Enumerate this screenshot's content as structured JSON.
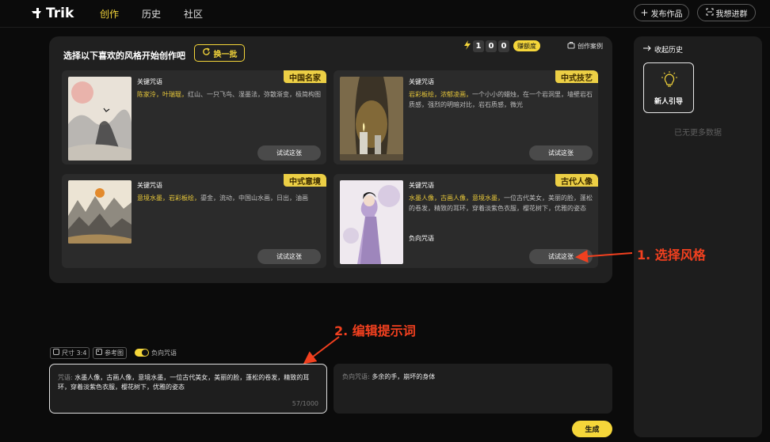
{
  "brand": {
    "name": "Trik"
  },
  "nav": [
    {
      "label": "创作",
      "active": true
    },
    {
      "label": "历史",
      "active": false
    },
    {
      "label": "社区",
      "active": false
    }
  ],
  "header_actions": {
    "publish": "发布作品",
    "join_group": "我想进群"
  },
  "panel": {
    "title": "选择以下喜欢的风格开始创作吧",
    "swap_button": "换一批",
    "credits": [
      "1",
      "0",
      "0"
    ],
    "quota_label": "赚额度",
    "cases_label": "创作案例"
  },
  "cards": [
    {
      "tag": "中国名家",
      "keyword_label": "关键咒语",
      "highlights": "陈家泠，叶瑞琨，",
      "desc": "红山、一只飞鸟、湿墨法，弥散渐变，极简构图",
      "negative_label": "",
      "button": "试试这张"
    },
    {
      "tag": "中式技艺",
      "keyword_label": "关键咒语",
      "highlights": "岩彩板绘，浓郁凌画，",
      "desc": "一个小小的蜡烛，在一个岩洞里，墙壁岩石质感，强烈的明暗对比，岩石质感，微光",
      "negative_label": "",
      "button": "试试这张"
    },
    {
      "tag": "中式意境",
      "keyword_label": "关键咒语",
      "highlights": "意境水墨，岩彩板绘，",
      "desc": "鎏金，流动，中国山水画，日出，油画",
      "negative_label": "",
      "button": "试试这张"
    },
    {
      "tag": "古代人像",
      "keyword_label": "关键咒语",
      "highlights": "水墨人像，古画人像，意境水墨，",
      "desc": "一位古代美女，美丽的脸，蓬松的卷发，精致的耳环，穿着淡紫色衣服，樱花树下，优雅的姿态",
      "negative_label": "负向咒语",
      "button": "试试这张"
    }
  ],
  "sidebar": {
    "title": "收起历史",
    "guide_label": "新人引导",
    "empty_text": "已无更多数据"
  },
  "options": {
    "size": "尺寸 3:4",
    "reference": "参考图",
    "negative_toggle": "负向咒语"
  },
  "prompt": {
    "label": "咒语:",
    "text": "水墨人像，古画人像，意境水墨，一位古代美女，美丽的脸，蓬松的卷发，精致的耳环，穿着淡紫色衣服，樱花树下，优雅的姿态",
    "counter": "57/1000"
  },
  "negative_prompt": {
    "label": "负向咒语:",
    "text": "多余的手，崩坏的身体"
  },
  "generate_button": "生成",
  "annotations": {
    "step1": "1. 选择风格",
    "step2": "2. 编辑提示词"
  },
  "colors": {
    "accent": "#f5d63a",
    "annotation": "#f2401f",
    "panel": "#202020",
    "card": "#2b2b2b"
  }
}
